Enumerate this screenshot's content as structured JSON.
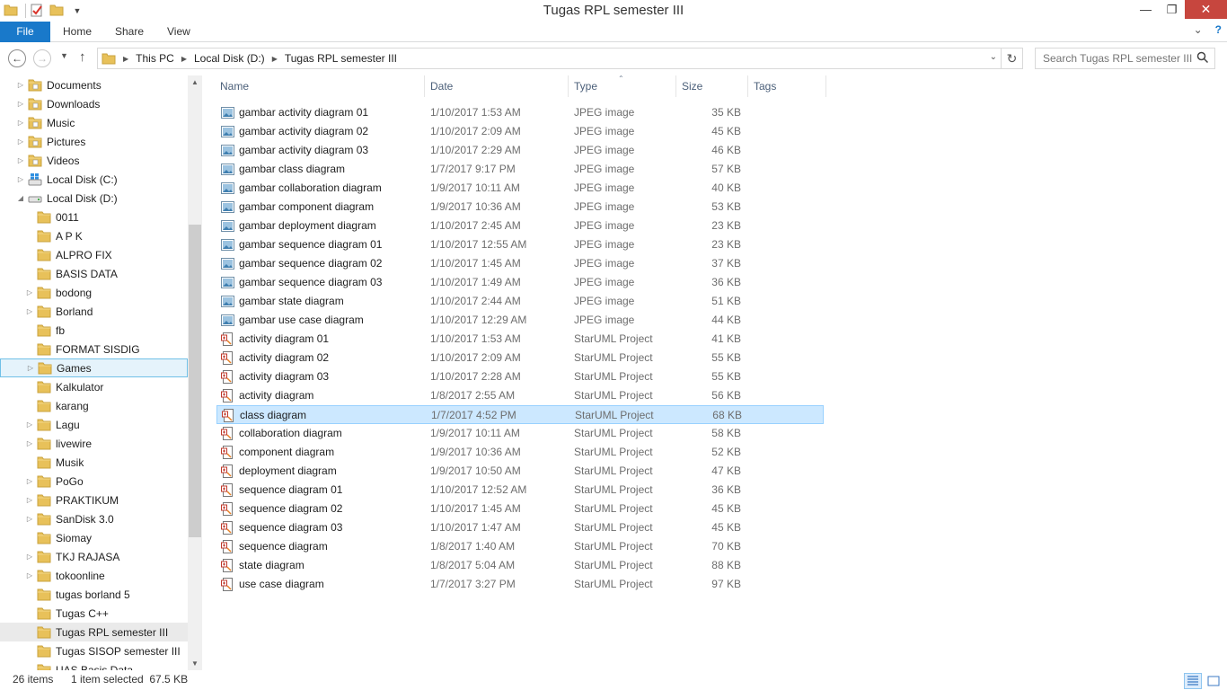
{
  "window": {
    "title": "Tugas RPL semester III"
  },
  "ribbon": {
    "tabs": [
      "File",
      "Home",
      "Share",
      "View"
    ]
  },
  "address": {
    "crumbs": [
      "This PC",
      "Local Disk (D:)",
      "Tugas RPL semester III"
    ],
    "search_placeholder": "Search Tugas RPL semester III"
  },
  "nav": {
    "items": [
      {
        "label": "Documents",
        "level": 1,
        "exp": "collapsed",
        "icon": "documents-folder-icon"
      },
      {
        "label": "Downloads",
        "level": 1,
        "exp": "collapsed",
        "icon": "downloads-folder-icon"
      },
      {
        "label": "Music",
        "level": 1,
        "exp": "collapsed",
        "icon": "music-folder-icon"
      },
      {
        "label": "Pictures",
        "level": 1,
        "exp": "collapsed",
        "icon": "pictures-folder-icon"
      },
      {
        "label": "Videos",
        "level": 1,
        "exp": "collapsed",
        "icon": "videos-folder-icon"
      },
      {
        "label": "Local Disk (C:)",
        "level": 1,
        "exp": "collapsed",
        "icon": "windows-drive-icon"
      },
      {
        "label": "Local Disk (D:)",
        "level": 1,
        "exp": "expanded",
        "icon": "drive-icon"
      },
      {
        "label": "0011",
        "level": 2,
        "exp": "none",
        "icon": "folder-icon"
      },
      {
        "label": "A P K",
        "level": 2,
        "exp": "none",
        "icon": "folder-icon"
      },
      {
        "label": "ALPRO FIX",
        "level": 2,
        "exp": "none",
        "icon": "folder-icon"
      },
      {
        "label": "BASIS DATA",
        "level": 2,
        "exp": "none",
        "icon": "folder-icon"
      },
      {
        "label": "bodong",
        "level": 2,
        "exp": "collapsed",
        "icon": "folder-icon"
      },
      {
        "label": "Borland",
        "level": 2,
        "exp": "collapsed",
        "icon": "folder-icon"
      },
      {
        "label": "fb",
        "level": 2,
        "exp": "none",
        "icon": "folder-icon"
      },
      {
        "label": "FORMAT SISDIG",
        "level": 2,
        "exp": "none",
        "icon": "folder-icon"
      },
      {
        "label": "Games",
        "level": 2,
        "exp": "collapsed",
        "icon": "folder-icon",
        "state": "hover"
      },
      {
        "label": "Kalkulator",
        "level": 2,
        "exp": "none",
        "icon": "folder-icon"
      },
      {
        "label": "karang",
        "level": 2,
        "exp": "none",
        "icon": "folder-icon"
      },
      {
        "label": "Lagu",
        "level": 2,
        "exp": "collapsed",
        "icon": "folder-icon"
      },
      {
        "label": "livewire",
        "level": 2,
        "exp": "collapsed",
        "icon": "folder-icon"
      },
      {
        "label": "Musik",
        "level": 2,
        "exp": "none",
        "icon": "folder-icon"
      },
      {
        "label": "PoGo",
        "level": 2,
        "exp": "collapsed",
        "icon": "folder-icon"
      },
      {
        "label": "PRAKTIKUM",
        "level": 2,
        "exp": "collapsed",
        "icon": "folder-icon"
      },
      {
        "label": "SanDisk 3.0",
        "level": 2,
        "exp": "collapsed",
        "icon": "folder-icon"
      },
      {
        "label": "Siomay",
        "level": 2,
        "exp": "none",
        "icon": "folder-icon"
      },
      {
        "label": "TKJ RAJASA",
        "level": 2,
        "exp": "collapsed",
        "icon": "folder-icon"
      },
      {
        "label": "tokoonline",
        "level": 2,
        "exp": "collapsed",
        "icon": "folder-icon"
      },
      {
        "label": "tugas borland 5",
        "level": 2,
        "exp": "none",
        "icon": "folder-icon"
      },
      {
        "label": "Tugas C++",
        "level": 2,
        "exp": "none",
        "icon": "folder-icon"
      },
      {
        "label": "Tugas RPL semester III",
        "level": 2,
        "exp": "none",
        "icon": "folder-icon",
        "state": "current"
      },
      {
        "label": "Tugas SISOP semester III",
        "level": 2,
        "exp": "none",
        "icon": "folder-icon"
      },
      {
        "label": "UAS Basis Data",
        "level": 2,
        "exp": "none",
        "icon": "folder-icon"
      }
    ]
  },
  "columns": [
    "Name",
    "Date",
    "Type",
    "Size",
    "Tags"
  ],
  "files": [
    {
      "name": "gambar activity diagram 01",
      "date": "1/10/2017 1:53 AM",
      "type": "JPEG image",
      "size": "35 KB",
      "icon": "jpeg-image-icon"
    },
    {
      "name": "gambar activity diagram 02",
      "date": "1/10/2017 2:09 AM",
      "type": "JPEG image",
      "size": "45 KB",
      "icon": "jpeg-image-icon"
    },
    {
      "name": "gambar activity diagram 03",
      "date": "1/10/2017 2:29 AM",
      "type": "JPEG image",
      "size": "46 KB",
      "icon": "jpeg-image-icon"
    },
    {
      "name": "gambar class diagram",
      "date": "1/7/2017 9:17 PM",
      "type": "JPEG image",
      "size": "57 KB",
      "icon": "jpeg-image-icon"
    },
    {
      "name": "gambar collaboration diagram",
      "date": "1/9/2017 10:11 AM",
      "type": "JPEG image",
      "size": "40 KB",
      "icon": "jpeg-image-icon"
    },
    {
      "name": "gambar component diagram",
      "date": "1/9/2017 10:36 AM",
      "type": "JPEG image",
      "size": "53 KB",
      "icon": "jpeg-image-icon"
    },
    {
      "name": "gambar deployment diagram",
      "date": "1/10/2017 2:45 AM",
      "type": "JPEG image",
      "size": "23 KB",
      "icon": "jpeg-image-icon"
    },
    {
      "name": "gambar sequence diagram 01",
      "date": "1/10/2017 12:55 AM",
      "type": "JPEG image",
      "size": "23 KB",
      "icon": "jpeg-image-icon"
    },
    {
      "name": "gambar sequence diagram 02",
      "date": "1/10/2017 1:45 AM",
      "type": "JPEG image",
      "size": "37 KB",
      "icon": "jpeg-image-icon"
    },
    {
      "name": "gambar sequence diagram 03",
      "date": "1/10/2017 1:49 AM",
      "type": "JPEG image",
      "size": "36 KB",
      "icon": "jpeg-image-icon"
    },
    {
      "name": "gambar state diagram",
      "date": "1/10/2017 2:44 AM",
      "type": "JPEG image",
      "size": "51 KB",
      "icon": "jpeg-image-icon"
    },
    {
      "name": "gambar use case diagram",
      "date": "1/10/2017 12:29 AM",
      "type": "JPEG image",
      "size": "44 KB",
      "icon": "jpeg-image-icon"
    },
    {
      "name": "activity diagram 01",
      "date": "1/10/2017 1:53 AM",
      "type": "StarUML Project",
      "size": "41 KB",
      "icon": "staruml-project-icon"
    },
    {
      "name": "activity diagram 02",
      "date": "1/10/2017 2:09 AM",
      "type": "StarUML Project",
      "size": "55 KB",
      "icon": "staruml-project-icon"
    },
    {
      "name": "activity diagram 03",
      "date": "1/10/2017 2:28 AM",
      "type": "StarUML Project",
      "size": "55 KB",
      "icon": "staruml-project-icon"
    },
    {
      "name": "activity diagram",
      "date": "1/8/2017 2:55 AM",
      "type": "StarUML Project",
      "size": "56 KB",
      "icon": "staruml-project-icon"
    },
    {
      "name": "class diagram",
      "date": "1/7/2017 4:52 PM",
      "type": "StarUML Project",
      "size": "68 KB",
      "icon": "staruml-project-icon",
      "selected": true
    },
    {
      "name": "collaboration diagram",
      "date": "1/9/2017 10:11 AM",
      "type": "StarUML Project",
      "size": "58 KB",
      "icon": "staruml-project-icon"
    },
    {
      "name": "component diagram",
      "date": "1/9/2017 10:36 AM",
      "type": "StarUML Project",
      "size": "52 KB",
      "icon": "staruml-project-icon"
    },
    {
      "name": "deployment diagram",
      "date": "1/9/2017 10:50 AM",
      "type": "StarUML Project",
      "size": "47 KB",
      "icon": "staruml-project-icon"
    },
    {
      "name": "sequence diagram 01",
      "date": "1/10/2017 12:52 AM",
      "type": "StarUML Project",
      "size": "36 KB",
      "icon": "staruml-project-icon"
    },
    {
      "name": "sequence diagram 02",
      "date": "1/10/2017 1:45 AM",
      "type": "StarUML Project",
      "size": "45 KB",
      "icon": "staruml-project-icon"
    },
    {
      "name": "sequence diagram 03",
      "date": "1/10/2017 1:47 AM",
      "type": "StarUML Project",
      "size": "45 KB",
      "icon": "staruml-project-icon"
    },
    {
      "name": "sequence diagram",
      "date": "1/8/2017 1:40 AM",
      "type": "StarUML Project",
      "size": "70 KB",
      "icon": "staruml-project-icon"
    },
    {
      "name": "state diagram",
      "date": "1/8/2017 5:04 AM",
      "type": "StarUML Project",
      "size": "88 KB",
      "icon": "staruml-project-icon"
    },
    {
      "name": "use case diagram",
      "date": "1/7/2017 3:27 PM",
      "type": "StarUML Project",
      "size": "97 KB",
      "icon": "staruml-project-icon"
    }
  ],
  "status": {
    "item_count": "26 items",
    "selection": "1 item selected  67.5 KB"
  },
  "colors": {
    "file_tab": "#1979ca",
    "close_button": "#c7463e",
    "selection_fill": "#cce8ff",
    "selection_border": "#99d1ff",
    "folder": "#e8c15a"
  }
}
